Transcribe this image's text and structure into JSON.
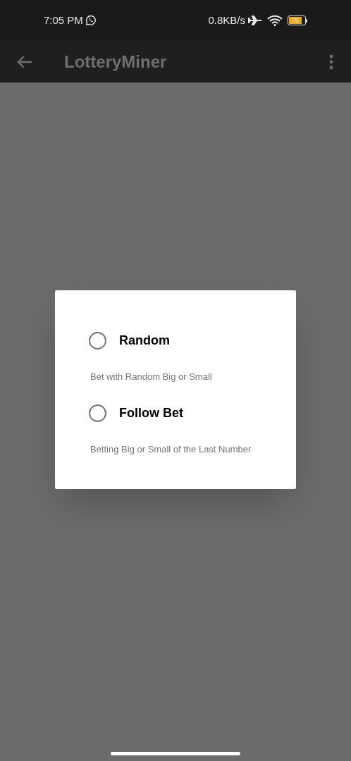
{
  "status_bar": {
    "time": "7:05 PM",
    "speed": "0.8KB/s",
    "battery": "79"
  },
  "app_bar": {
    "title": "LotteryMiner"
  },
  "dialog": {
    "options": [
      {
        "label": "Random",
        "description": "Bet with Random Big or Small",
        "selected": false
      },
      {
        "label": "Follow Bet",
        "description": "Betting Big or Small of the Last Number",
        "selected": false
      }
    ]
  }
}
